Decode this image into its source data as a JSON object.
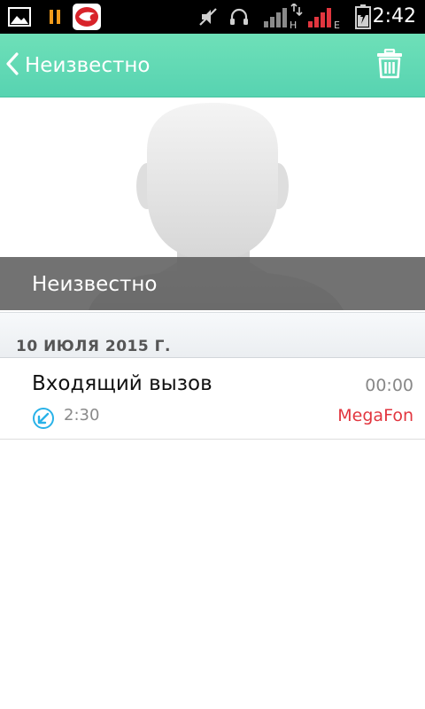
{
  "status_bar": {
    "time": "2:42",
    "icons": [
      "gallery-icon",
      "pause-icon",
      "app-badge-icon",
      "mute-icon",
      "headset-icon",
      "signal-h-icon",
      "signal-e-icon",
      "battery-icon"
    ],
    "signal_1_label": "H",
    "signal_2_label": "E"
  },
  "app_bar": {
    "title": "Неизвестно",
    "back_icon": "chevron-left-icon",
    "delete_icon": "trash-icon",
    "background_color": "#5fd9b5"
  },
  "contact": {
    "name": "Неизвестно",
    "avatar_icon": "person-silhouette-icon"
  },
  "call_log": {
    "date_header": "10 ИЮЛЯ 2015 Г.",
    "entries": [
      {
        "type": "Входящий вызов",
        "duration": "00:00",
        "time": "2:30",
        "carrier": "MegaFon",
        "icon": "incoming-call-icon",
        "carrier_color": "#e2363f"
      }
    ]
  }
}
